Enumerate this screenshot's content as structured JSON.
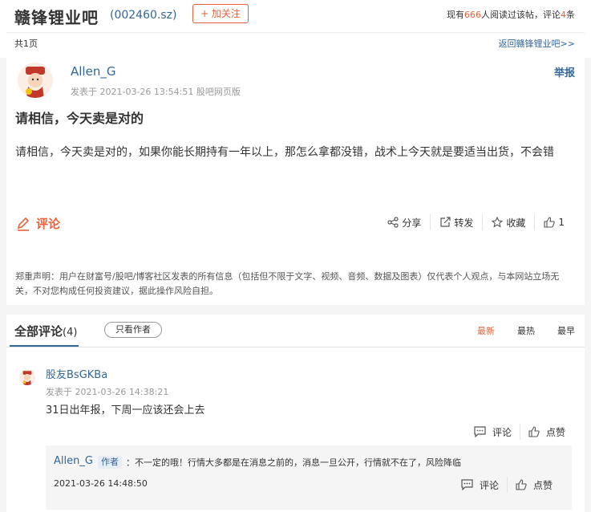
{
  "header": {
    "forum_name": "赣锋锂业吧",
    "stock_code": "(002460.sz)",
    "follow_label": "+ 加关注",
    "stats_prefix": "现有",
    "stats_readers": "666",
    "stats_middle": "人阅读过该帖，评论",
    "stats_comments": "4",
    "stats_suffix": "条",
    "page_count": "共1页",
    "back_link": "返回赣锋锂业吧>>"
  },
  "post": {
    "author": "Allen_G",
    "meta": "发表于 2021-03-26 13:54:51 股吧网页版",
    "report_label": "举报",
    "title": "请相信，今天卖是对的",
    "body": "请相信，今天卖是对的，如果你能长期持有一年以上，那怎么拿都没错，战术上今天就是要适当出货，不会错",
    "comment_label": "评论",
    "actions": {
      "share": "分享",
      "repost": "转发",
      "favorite": "收藏",
      "like_count": "1"
    },
    "disclaimer": "郑重声明：用户在财富号/股吧/博客社区发表的所有信息（包括但不限于文字、视频、音频、数据及图表）仅代表个人观点，与本网站立场无关，不对您构成任何投资建议，据此操作风险自担。"
  },
  "comments": {
    "title": "全部评论",
    "count": "(4)",
    "author_only": "只看作者",
    "sort_newest": "最新",
    "sort_hot": "最热",
    "sort_early": "最早",
    "items": [
      {
        "name": "股友BsGKBa",
        "meta": "发表于 2021-03-26 14:38:21",
        "text": "31日出年报，下周一应该还会上去",
        "comment_label": "评论",
        "like_label": "点赞",
        "reply": {
          "name": "Allen_G",
          "tag": "作者",
          "text": "：不一定的哦！行情大多都是在消息之前的，消息一旦公开，行情就不在了，风险降临",
          "date": "2021-03-26 14:48:50",
          "comment_label": "评论",
          "like_label": "点赞"
        }
      }
    ]
  },
  "colors": {
    "accent": "#e8613a",
    "link": "#336699"
  }
}
